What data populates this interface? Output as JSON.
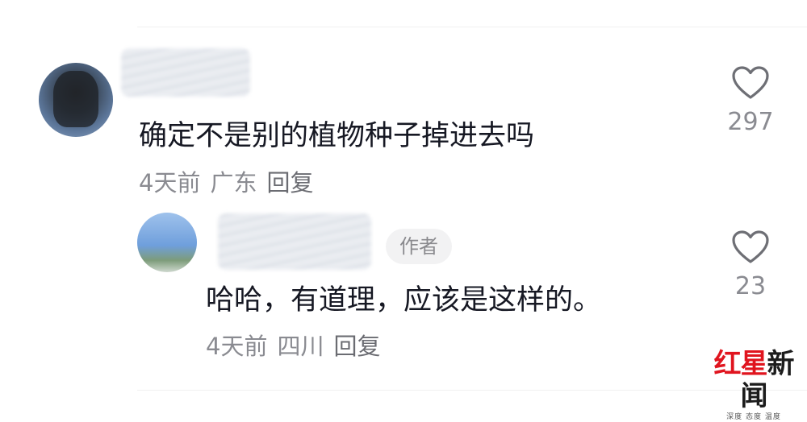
{
  "comments": [
    {
      "text": "确定不是别的植物种子掉进去吗",
      "time": "4天前",
      "location": "广东",
      "reply_label": "回复",
      "likes": "297"
    },
    {
      "author_badge": "作者",
      "text": "哈哈，有道理，应该是这样的。",
      "time": "4天前",
      "location": "四川",
      "reply_label": "回复",
      "likes": "23"
    }
  ],
  "watermark": {
    "red_part": "红星",
    "dark_part": "新闻",
    "subtitle": "深度 态度 温度"
  },
  "icons": {
    "like": "heart-outline-icon"
  },
  "colors": {
    "text_primary": "#161823",
    "text_secondary": "#8a8b91",
    "badge_bg": "#f2f2f3",
    "watermark_red": "#e0141e"
  }
}
